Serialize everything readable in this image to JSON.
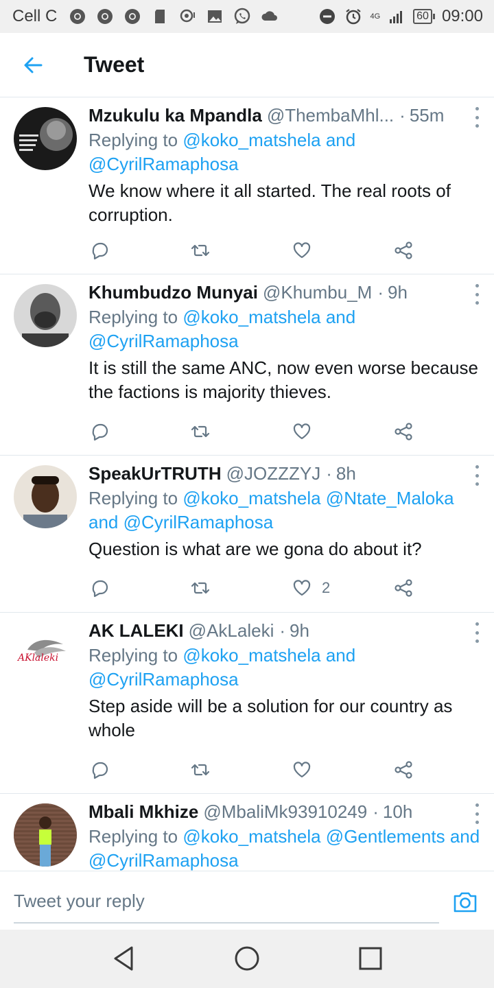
{
  "status_bar": {
    "carrier": "Cell C",
    "network": "4G",
    "battery": "60",
    "time": "09:00"
  },
  "header": {
    "title": "Tweet"
  },
  "tweets": [
    {
      "name": "Mzukulu ka Mpandla",
      "handle": "@ThembaMhl...",
      "time": "55m",
      "replying_prefix": "Replying to",
      "mentions_1": "@koko_matshela",
      "joiner": "and",
      "mentions_2": "@CyrilRamaphosa",
      "text": "We know where it all started. The real roots of corruption.",
      "likes": ""
    },
    {
      "name": "Khumbudzo Munyai",
      "handle": "@Khumbu_M",
      "time": "9h",
      "replying_prefix": "Replying to",
      "mentions_1": "@koko_matshela",
      "joiner": "and",
      "mentions_2": "@CyrilRamaphosa",
      "text": "It is still the same ANC, now even worse because the factions is majority thieves.",
      "likes": ""
    },
    {
      "name": "SpeakUrTRUTH",
      "handle": "@JOZZZYJ",
      "time": "8h",
      "replying_prefix": "Replying to",
      "mentions_1": "@koko_matshela @Ntate_Maloka",
      "joiner": "and",
      "mentions_2": "@CyrilRamaphosa",
      "text": "Question is what are we gona do about it?",
      "likes": "2"
    },
    {
      "name": "AK LALEKI",
      "handle": "@AkLaleki",
      "time": "9h",
      "replying_prefix": "Replying to",
      "mentions_1": "@koko_matshela",
      "joiner": "and",
      "mentions_2": "@CyrilRamaphosa",
      "text": "Step aside will be a solution for our country as whole",
      "likes": ""
    },
    {
      "name": "Mbali Mkhize",
      "handle": "@MbaliMk93910249",
      "time": "10h",
      "replying_prefix": "Replying to",
      "mentions_1": "@koko_matshela @Gentlements",
      "joiner": "and",
      "mentions_2": "@CyrilRamaphosa",
      "text": "",
      "likes": ""
    }
  ],
  "reply_bar": {
    "placeholder": "Tweet your reply"
  },
  "icons": {
    "back": "back-arrow-icon",
    "reply": "reply-icon",
    "retweet": "retweet-icon",
    "like": "heart-icon",
    "share": "share-icon",
    "camera": "camera-icon",
    "nav_back": "triangle-back-icon",
    "nav_home": "circle-home-icon",
    "nav_recents": "square-recents-icon"
  },
  "colors": {
    "accent": "#1da1f2",
    "secondary_text": "#657786",
    "divider": "#e1e8ed",
    "system_bar": "#f0f0f0"
  }
}
